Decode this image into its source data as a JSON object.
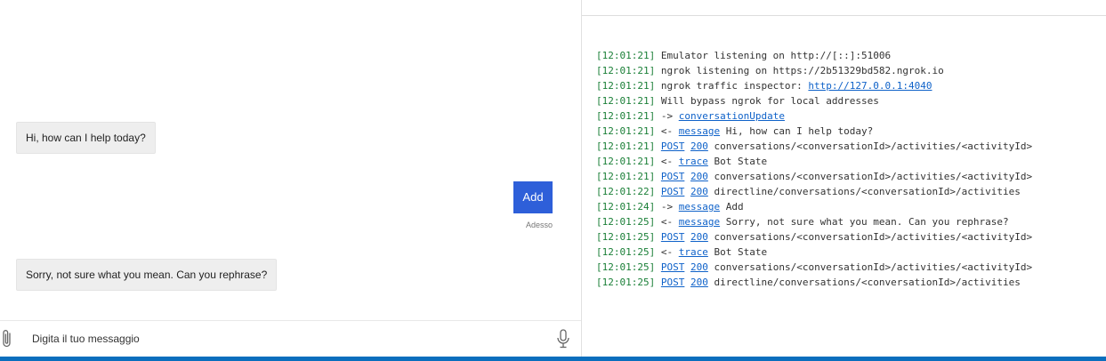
{
  "chat": {
    "messages": [
      {
        "from": "bot",
        "text": "Hi, how can I help today?"
      },
      {
        "from": "user",
        "text": "Add",
        "time": "Adesso"
      },
      {
        "from": "bot",
        "text": "Sorry, not sure what you mean. Can you rephrase?"
      }
    ],
    "input": {
      "placeholder": "Digita il tuo messaggio",
      "value": ""
    },
    "icons": {
      "attach": "paperclip-icon",
      "mic": "microphone-icon"
    },
    "colors": {
      "user_bubble": "#2e5fd9",
      "bot_bubble": "#eeeeee"
    }
  },
  "log": {
    "colors": {
      "timestamp": "#1a7f37",
      "link": "#0f62c9",
      "text": "#333333",
      "bottom_bar": "#0a6ebd"
    },
    "lines": [
      {
        "time": "[12:01:21]",
        "parts": [
          {
            "t": " Emulator listening on http://[::]:51006"
          }
        ]
      },
      {
        "time": "[12:01:21]",
        "parts": [
          {
            "t": " ngrok listening on https://2b51329bd582.ngrok.io"
          }
        ]
      },
      {
        "time": "[12:01:21]",
        "parts": [
          {
            "t": " ngrok traffic inspector: "
          },
          {
            "t": "http://127.0.0.1:4040",
            "link": true
          }
        ]
      },
      {
        "time": "[12:01:21]",
        "parts": [
          {
            "t": " Will bypass ngrok for local addresses"
          }
        ]
      },
      {
        "time": "[12:01:21]",
        "parts": [
          {
            "t": " -> "
          },
          {
            "t": "conversationUpdate",
            "link": true
          }
        ]
      },
      {
        "time": "[12:01:21]",
        "parts": [
          {
            "t": " <- "
          },
          {
            "t": "message",
            "link": true
          },
          {
            "t": " Hi, how can I help today?"
          }
        ]
      },
      {
        "time": "[12:01:21]",
        "parts": [
          {
            "t": " "
          },
          {
            "t": "POST",
            "link": true
          },
          {
            "t": " "
          },
          {
            "t": "200",
            "link": true
          },
          {
            "t": " conversations/<conversationId>/activities/<activityId>"
          }
        ]
      },
      {
        "time": "[12:01:21]",
        "parts": [
          {
            "t": " <- "
          },
          {
            "t": "trace",
            "link": true
          },
          {
            "t": " Bot State"
          }
        ]
      },
      {
        "time": "[12:01:21]",
        "parts": [
          {
            "t": " "
          },
          {
            "t": "POST",
            "link": true
          },
          {
            "t": " "
          },
          {
            "t": "200",
            "link": true
          },
          {
            "t": " conversations/<conversationId>/activities/<activityId>"
          }
        ]
      },
      {
        "time": "[12:01:22]",
        "parts": [
          {
            "t": " "
          },
          {
            "t": "POST",
            "link": true
          },
          {
            "t": " "
          },
          {
            "t": "200",
            "link": true
          },
          {
            "t": " directline/conversations/<conversationId>/activities"
          }
        ]
      },
      {
        "time": "[12:01:24]",
        "parts": [
          {
            "t": " -> "
          },
          {
            "t": "message",
            "link": true
          },
          {
            "t": " Add"
          }
        ]
      },
      {
        "time": "[12:01:25]",
        "parts": [
          {
            "t": " <- "
          },
          {
            "t": "message",
            "link": true
          },
          {
            "t": " Sorry, not sure what you mean. Can you rephrase?"
          }
        ]
      },
      {
        "time": "[12:01:25]",
        "parts": [
          {
            "t": " "
          },
          {
            "t": "POST",
            "link": true
          },
          {
            "t": " "
          },
          {
            "t": "200",
            "link": true
          },
          {
            "t": " conversations/<conversationId>/activities/<activityId>"
          }
        ]
      },
      {
        "time": "[12:01:25]",
        "parts": [
          {
            "t": " <- "
          },
          {
            "t": "trace",
            "link": true
          },
          {
            "t": " Bot State"
          }
        ]
      },
      {
        "time": "[12:01:25]",
        "parts": [
          {
            "t": " "
          },
          {
            "t": "POST",
            "link": true
          },
          {
            "t": " "
          },
          {
            "t": "200",
            "link": true
          },
          {
            "t": " conversations/<conversationId>/activities/<activityId>"
          }
        ]
      },
      {
        "time": "[12:01:25]",
        "parts": [
          {
            "t": " "
          },
          {
            "t": "POST",
            "link": true
          },
          {
            "t": " "
          },
          {
            "t": "200",
            "link": true
          },
          {
            "t": " directline/conversations/<conversationId>/activities"
          }
        ]
      }
    ]
  }
}
